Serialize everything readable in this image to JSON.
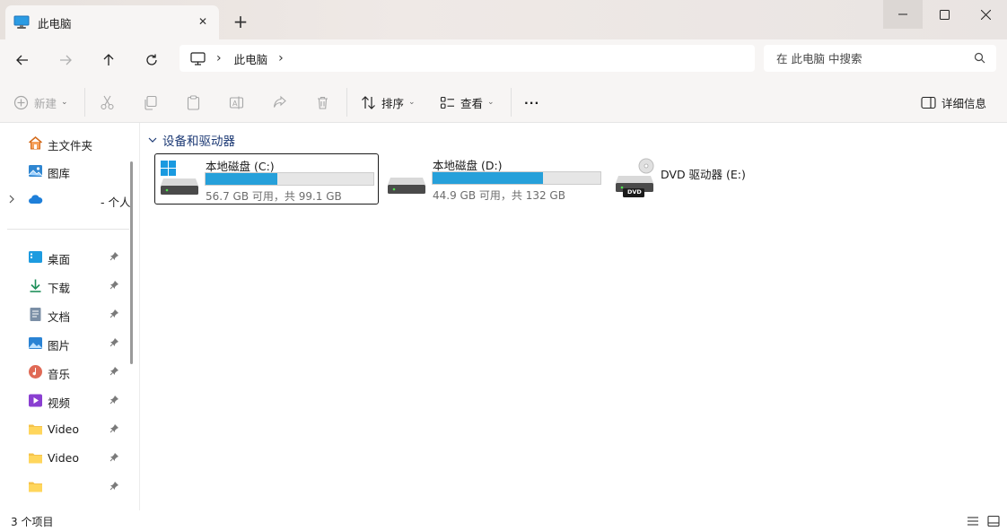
{
  "window": {
    "tab_title": "此电脑",
    "new_tab_symbol": "+",
    "close_tab_symbol": "✕"
  },
  "address": {
    "crumb": "此电脑",
    "separator": "›"
  },
  "search": {
    "placeholder": "在 此电脑 中搜索"
  },
  "toolbar": {
    "new_label": "新建",
    "sort_label": "排序",
    "view_label": "查看",
    "more_label": "···",
    "details_label": "详细信息"
  },
  "sidebar": {
    "items": [
      {
        "label": "主文件夹",
        "icon": "home-icon"
      },
      {
        "label": "图库",
        "icon": "gallery-icon"
      },
      {
        "label": "- 个人",
        "icon": "onedrive-icon"
      },
      {
        "label": "桌面",
        "icon": "desktop-icon"
      },
      {
        "label": "下载",
        "icon": "download-icon"
      },
      {
        "label": "文档",
        "icon": "documents-icon"
      },
      {
        "label": "图片",
        "icon": "pictures-icon"
      },
      {
        "label": "音乐",
        "icon": "music-icon"
      },
      {
        "label": "视频",
        "icon": "videos-icon"
      },
      {
        "label": "Video",
        "icon": "folder-icon"
      },
      {
        "label": "Video",
        "icon": "folder-icon"
      },
      {
        "label": "",
        "icon": "folder-icon"
      }
    ]
  },
  "content": {
    "group_title": "设备和驱动器",
    "drives": [
      {
        "name": "本地磁盘 (C:)",
        "size_text": "56.7 GB 可用，共 99.1 GB",
        "used_fraction": 0.428
      },
      {
        "name": "本地磁盘 (D:)",
        "size_text": "44.9 GB 可用，共 132 GB",
        "used_fraction": 0.66
      },
      {
        "name": "DVD 驱动器 (E:)",
        "dvd_label": "DVD"
      }
    ]
  },
  "status": {
    "count": "3 个项目"
  },
  "colors": {
    "accent": "#26a0da",
    "group_header": "#1d3a75",
    "chrome_bg": "#f7f5f4"
  }
}
